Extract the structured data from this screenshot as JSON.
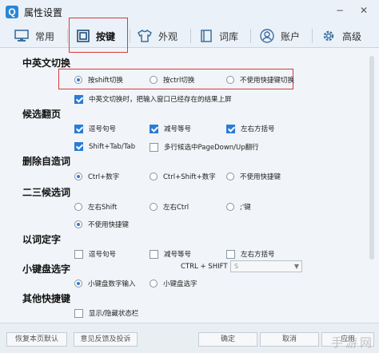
{
  "window": {
    "logo_letter": "Q",
    "title": "属性设置",
    "min_glyph": "−",
    "close_glyph": "✕"
  },
  "tabs": [
    {
      "label": "常用",
      "icon": "monitor-icon"
    },
    {
      "label": "按键",
      "icon": "keyboard-icon",
      "active": true
    },
    {
      "label": "外观",
      "icon": "shirt-icon"
    },
    {
      "label": "词库",
      "icon": "book-icon"
    },
    {
      "label": "账户",
      "icon": "user-icon"
    },
    {
      "label": "高级",
      "icon": "gear-icon"
    }
  ],
  "sections": {
    "cn_en_switch": {
      "title": "中英文切换",
      "options": [
        "按shift切换",
        "按ctrl切换",
        "不使用快捷键切换"
      ],
      "checkbox": "中英文切换时，把输入窗口已经存在的结果上屏"
    },
    "candidate_page": {
      "title": "候选翻页",
      "options": [
        "逗号句号",
        "减号等号",
        "左右方括号",
        "Shift+Tab/Tab",
        "多行候选中PageDown/Up翻行"
      ]
    },
    "delete_word": {
      "title": "删除自造词",
      "options": [
        "Ctrl+数字",
        "Ctrl+Shift+数字",
        "不使用快捷键"
      ]
    },
    "second_third": {
      "title": "二三候选词",
      "options": [
        "左右Shift",
        "左右Ctrl",
        ";'键",
        "不使用快捷键"
      ]
    },
    "word_select": {
      "title": "以词定字",
      "options": [
        "逗号句号",
        "减号等号",
        "左右方括号"
      ]
    },
    "numpad": {
      "title": "小键盘选字",
      "options": [
        "小键盘数字输入",
        "小键盘选字"
      ]
    },
    "other": {
      "title": "其他快捷键",
      "checkbox": "显示/隐藏状态栏",
      "shortcut_label": "CTRL + SHIFT +",
      "shortcut_value": "S"
    }
  },
  "footer": {
    "restore": "恢复本页默认",
    "feedback": "意见反馈及投诉",
    "ok": "确定",
    "cancel": "取消",
    "apply": "应用"
  },
  "watermark": "手游网",
  "colors": {
    "accent": "#2b7cd3",
    "highlight": "#d83a3a"
  }
}
